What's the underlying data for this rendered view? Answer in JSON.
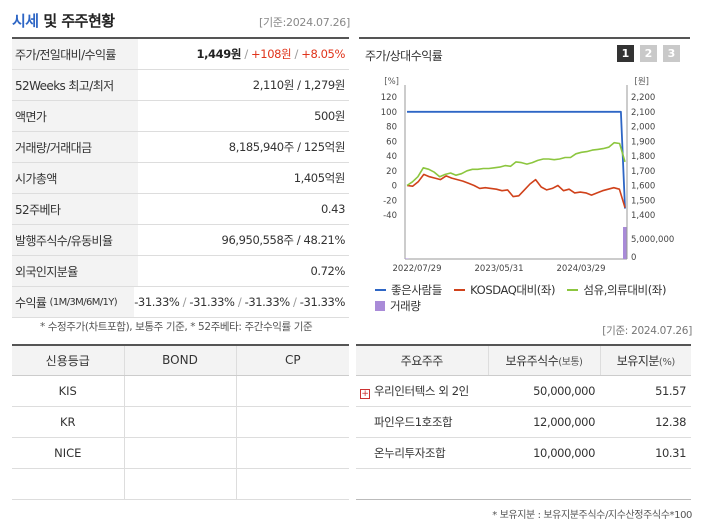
{
  "header": {
    "title_main": "시세",
    "title_rest": " 및 주주현황",
    "asof": "[기준:2024.07.26]"
  },
  "quote": {
    "rows": [
      {
        "label": "주가/전일대비/수익률",
        "price": "1,449원",
        "change": "+108원",
        "rate": "+8.05%"
      },
      {
        "label": "52Weeks 최고/최저",
        "value": "2,110원 / 1,279원"
      },
      {
        "label": "액면가",
        "value": "500원"
      },
      {
        "label": "거래량/거래대금",
        "value": "8,185,940주 / 125억원"
      },
      {
        "label": "시가총액",
        "value": "1,405억원"
      },
      {
        "label": "52주베타",
        "value": "0.43"
      },
      {
        "label": "발행주식수/유동비율",
        "value": "96,950,558주 / 48.21%"
      },
      {
        "label": "외국인지분율",
        "value": "0.72%"
      },
      {
        "label": "수익률",
        "label_sub": "(1M/3M/6M/1Y)",
        "returns": [
          "-31.33%",
          "-31.33%",
          "-31.33%",
          "-31.33%"
        ]
      }
    ]
  },
  "footnote_left": "* 수정주가(차트포함), 보통주 기준, * 52주베타: 주간수익률 기준",
  "asof_right": "[기준: 2024.07.26]",
  "chart_panel": {
    "title": "주가/상대수익률",
    "tabs": [
      "1",
      "2",
      "3"
    ],
    "active_tab": 0
  },
  "chart_data": {
    "type": "line",
    "left_axis_unit": "[%]",
    "right_axis_unit": "[원]",
    "left_ticks": [
      120,
      100,
      80,
      60,
      40,
      20,
      0,
      -20,
      -40
    ],
    "right_ticks": [
      2200,
      2100,
      2000,
      1900,
      1800,
      1700,
      1600,
      1500,
      1400
    ],
    "volume_ticks": [
      "5,000,000",
      "0"
    ],
    "x_labels": [
      "2022/07/29",
      "2023/05/31",
      "2024/03/29"
    ],
    "ylim_left": [
      -40,
      120
    ],
    "series": [
      {
        "name": "좋은사람들",
        "color": "#2e66c5",
        "values": [
          100,
          100,
          100,
          100,
          100,
          100,
          100,
          100,
          100,
          100,
          100,
          100,
          100,
          100,
          100,
          100,
          100,
          100,
          100,
          100,
          100,
          100,
          100,
          100,
          100,
          100,
          100,
          100,
          100,
          100,
          100,
          100,
          100,
          100,
          100,
          100,
          100,
          100,
          100,
          100,
          100,
          100,
          100,
          100,
          100,
          100,
          100,
          100,
          100,
          100,
          100,
          100,
          100,
          -31.33
        ]
      },
      {
        "name": "KOSDAQ대비(좌)",
        "color": "#d0421b",
        "values": [
          0,
          -1,
          5,
          15,
          12,
          10,
          8,
          13,
          10,
          8,
          6,
          3,
          0,
          -4,
          -3,
          -4,
          -5,
          -7,
          -6,
          -15,
          -14,
          -6,
          2,
          8,
          -2,
          -6,
          -4,
          0,
          -7,
          -5,
          -10,
          -9,
          -10,
          -13,
          -10,
          -7,
          -5,
          -3,
          -5,
          -30
        ]
      },
      {
        "name": "섬유,의류대비(좌)",
        "color": "#8cc63f",
        "values": [
          0,
          5,
          12,
          24,
          22,
          18,
          12,
          15,
          17,
          14,
          16,
          20,
          22,
          22,
          23,
          23,
          24,
          25,
          27,
          26,
          32,
          31,
          29,
          31,
          34,
          36,
          36,
          35,
          36,
          38,
          38,
          43,
          45,
          46,
          48,
          49,
          50,
          52,
          58,
          57,
          32
        ]
      }
    ],
    "volume_series": {
      "name": "거래량",
      "color": "#a98bd8",
      "values": [
        0.02,
        0.0,
        0.0,
        0.0,
        0.0,
        0.0,
        0.0,
        0.0,
        0.0,
        0.0,
        0.0,
        0.0,
        0.0,
        0.0,
        0.0,
        0.0,
        0.0,
        0.0,
        0.0,
        0.0,
        0.0,
        0.0,
        0.0,
        0.0,
        0.0,
        0.0,
        0.0,
        0.0,
        0.0,
        0.0,
        0.0,
        0.0,
        0.0,
        0.0,
        0.0,
        0.0,
        0.0,
        0.0,
        0.0,
        8185940
      ]
    },
    "legend": [
      "좋은사람들",
      "KOSDAQ대비(좌)",
      "섬유,의류대비(좌)",
      "거래량"
    ]
  },
  "credit": {
    "headers": [
      "신용등급",
      "BOND",
      "CP"
    ],
    "rows": [
      [
        "KIS",
        "",
        ""
      ],
      [
        "KR",
        "",
        ""
      ],
      [
        "NICE",
        "",
        ""
      ],
      [
        "",
        "",
        ""
      ]
    ]
  },
  "holders": {
    "headers": [
      "주요주주",
      "보유주식수",
      "(보통)",
      "보유지분",
      "(%)"
    ],
    "rows": [
      {
        "name": "우리인터텍스 외 2인",
        "shares": "50,000,000",
        "pct": "51.57",
        "expandable": true
      },
      {
        "name": "파인우드1호조합",
        "shares": "12,000,000",
        "pct": "12.38",
        "expandable": false
      },
      {
        "name": "온누리투자조합",
        "shares": "10,000,000",
        "pct": "10.31",
        "expandable": false
      },
      {
        "name": "",
        "shares": "",
        "pct": "",
        "expandable": false
      }
    ]
  },
  "footnote_right": "* 보유지분 : 보유지분주식수/지수산정주식수*100",
  "icons": {
    "expand": "plus-icon"
  }
}
